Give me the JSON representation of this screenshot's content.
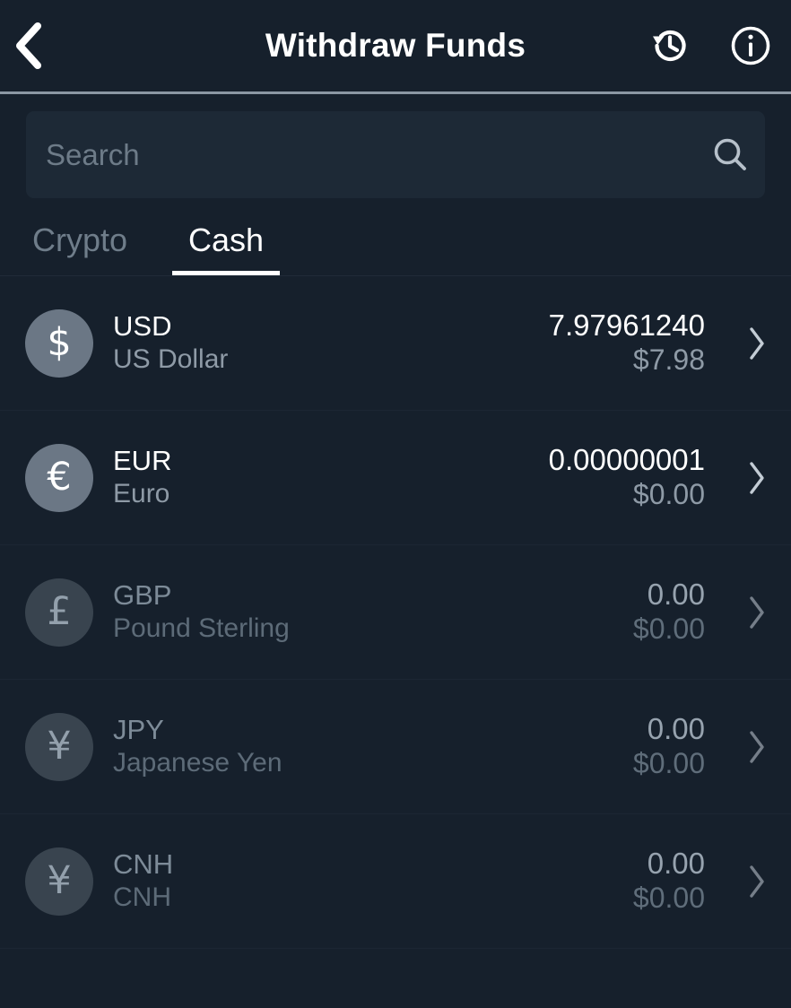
{
  "header": {
    "title": "Withdraw Funds",
    "back_icon": "chevron-left-icon",
    "history_icon": "history-clock-icon",
    "info_icon": "info-circle-icon"
  },
  "search": {
    "placeholder": "Search",
    "value": "",
    "icon": "search-icon"
  },
  "tabs": [
    {
      "label": "Crypto",
      "active": false
    },
    {
      "label": "Cash",
      "active": true
    }
  ],
  "colors": {
    "background": "#16202c",
    "search_field": "#1d2936",
    "avatar_active": "#6b7785",
    "avatar_dim": "#39444f",
    "text_primary": "#ffffff",
    "text_secondary": "#8e9aa6",
    "accent_underline": "#ffffff",
    "divider": "#1c2633"
  },
  "list": {
    "rows": [
      {
        "ticker": "USD",
        "name": "US Dollar",
        "amount": "7.97961240",
        "fiat": "$7.98",
        "glyph": "$",
        "icon": "usd-dollar-icon",
        "dim": false
      },
      {
        "ticker": "EUR",
        "name": "Euro",
        "amount": "0.00000001",
        "fiat": "$0.00",
        "glyph": "€",
        "icon": "eur-euro-icon",
        "dim": false
      },
      {
        "ticker": "GBP",
        "name": "Pound Sterling",
        "amount": "0.00",
        "fiat": "$0.00",
        "glyph": "£",
        "icon": "gbp-pound-icon",
        "dim": true
      },
      {
        "ticker": "JPY",
        "name": "Japanese Yen",
        "amount": "0.00",
        "fiat": "$0.00",
        "glyph": "¥",
        "icon": "jpy-yen-icon",
        "dim": true
      },
      {
        "ticker": "CNH",
        "name": "CNH",
        "amount": "0.00",
        "fiat": "$0.00",
        "glyph": "¥",
        "icon": "cnh-yuan-icon",
        "dim": true
      }
    ]
  }
}
